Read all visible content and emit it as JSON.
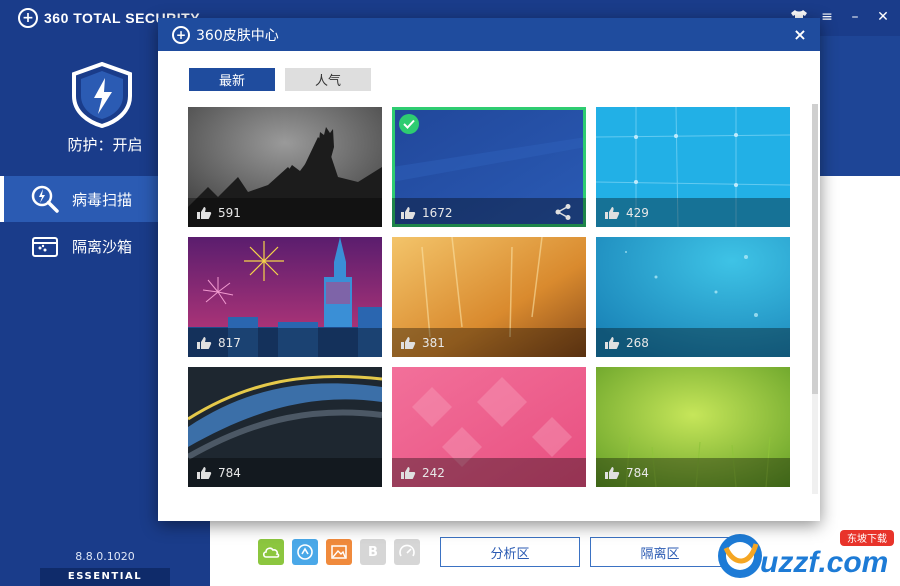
{
  "app": {
    "title": "360 TOTAL SECURITY",
    "protection_status": "防护：开启",
    "nav": [
      {
        "label": "病毒扫描",
        "active": true
      },
      {
        "label": "隔离沙箱",
        "active": false
      }
    ],
    "version": "8.8.0.1020",
    "edition": "ESSENTIAL",
    "window_controls": [
      "shirt-icon",
      "menu-icon",
      "minimize-icon",
      "close-icon"
    ],
    "buttons": {
      "analysis": "分析区",
      "quarantine": "隔离区"
    },
    "tools": [
      {
        "icon": "cloud-icon",
        "color": "#8cc63f"
      },
      {
        "icon": "speed-icon",
        "color": "#4aa8e8"
      },
      {
        "icon": "image-icon",
        "color": "#f08a3c"
      },
      {
        "icon": "b-icon",
        "label": "B",
        "color": "#d6d6d6"
      },
      {
        "icon": "gauge-icon",
        "color": "#d6d6d6"
      }
    ],
    "colors": {
      "sidebar": "#1a3c8a",
      "accent": "#1f4c9e",
      "selected": "#2ecc71"
    }
  },
  "watermark": {
    "brand": "uzzf.com",
    "tag": "东坡下载"
  },
  "skin_center": {
    "title": "360皮肤中心",
    "tabs": [
      {
        "label": "最新",
        "active": true
      },
      {
        "label": "人气",
        "active": false
      }
    ],
    "skins": [
      {
        "theme": "concert-crowd",
        "likes": "591",
        "selected": false
      },
      {
        "theme": "blue-solid",
        "likes": "1672",
        "selected": true
      },
      {
        "theme": "cyan-grid",
        "likes": "429",
        "selected": false
      },
      {
        "theme": "city-fireworks",
        "likes": "817",
        "selected": false
      },
      {
        "theme": "golden-wheat",
        "likes": "381",
        "selected": false
      },
      {
        "theme": "teal-bokeh",
        "likes": "268",
        "selected": false
      },
      {
        "theme": "light-streaks",
        "likes": "784",
        "selected": false
      },
      {
        "theme": "pink-diamonds",
        "likes": "242",
        "selected": false
      },
      {
        "theme": "green-meadow",
        "likes": "784",
        "selected": false
      }
    ]
  }
}
